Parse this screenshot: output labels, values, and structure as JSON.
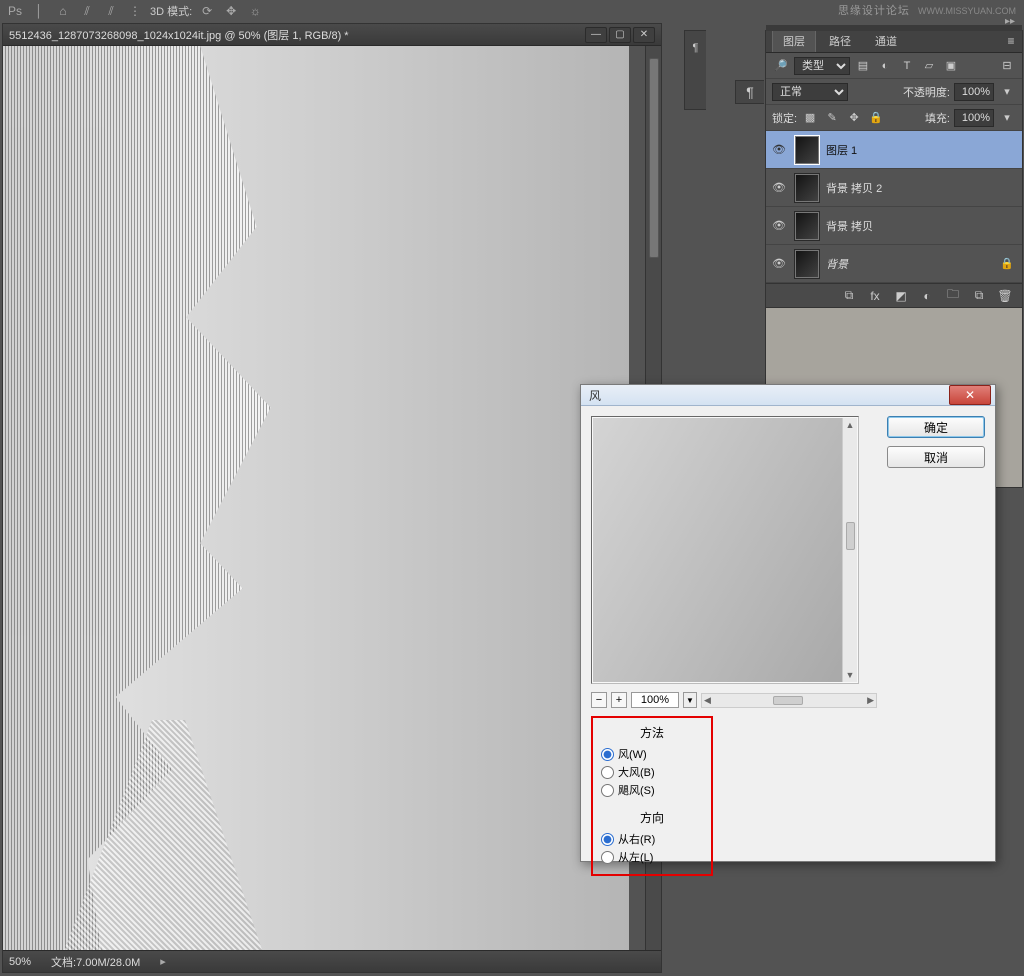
{
  "watermark": {
    "text": "思缘设计论坛",
    "url": "WWW.MISSYUAN.COM"
  },
  "topToolbar": {
    "mode3d": "3D 模式:"
  },
  "doc": {
    "title": "5512436_1287073268098_1024x1024it.jpg @ 50% (图层 1, RGB/8) *",
    "zoom": "50%",
    "status": "文档:7.00M/28.0M"
  },
  "layersPanel": {
    "tabs": [
      "图层",
      "路径",
      "通道"
    ],
    "kindLabel": "类型",
    "blend": "正常",
    "opacityLabel": "不透明度:",
    "opacity": "100%",
    "lockLabel": "锁定:",
    "fillLabel": "填充:",
    "fill": "100%",
    "layers": [
      {
        "name": "图层 1",
        "selected": true,
        "locked": false,
        "italic": false
      },
      {
        "name": "背景 拷贝 2",
        "selected": false,
        "locked": false,
        "italic": false
      },
      {
        "name": "背景 拷贝",
        "selected": false,
        "locked": false,
        "italic": false
      },
      {
        "name": "背景",
        "selected": false,
        "locked": true,
        "italic": true
      }
    ]
  },
  "dialog": {
    "title": "风",
    "ok": "确定",
    "cancel": "取消",
    "previewZoom": "100%",
    "method": {
      "label": "方法",
      "options": [
        {
          "label": "风(W)",
          "checked": true
        },
        {
          "label": "大风(B)",
          "checked": false
        },
        {
          "label": "飓风(S)",
          "checked": false
        }
      ]
    },
    "direction": {
      "label": "方向",
      "options": [
        {
          "label": "从右(R)",
          "checked": true
        },
        {
          "label": "从左(L)",
          "checked": false
        }
      ]
    }
  }
}
